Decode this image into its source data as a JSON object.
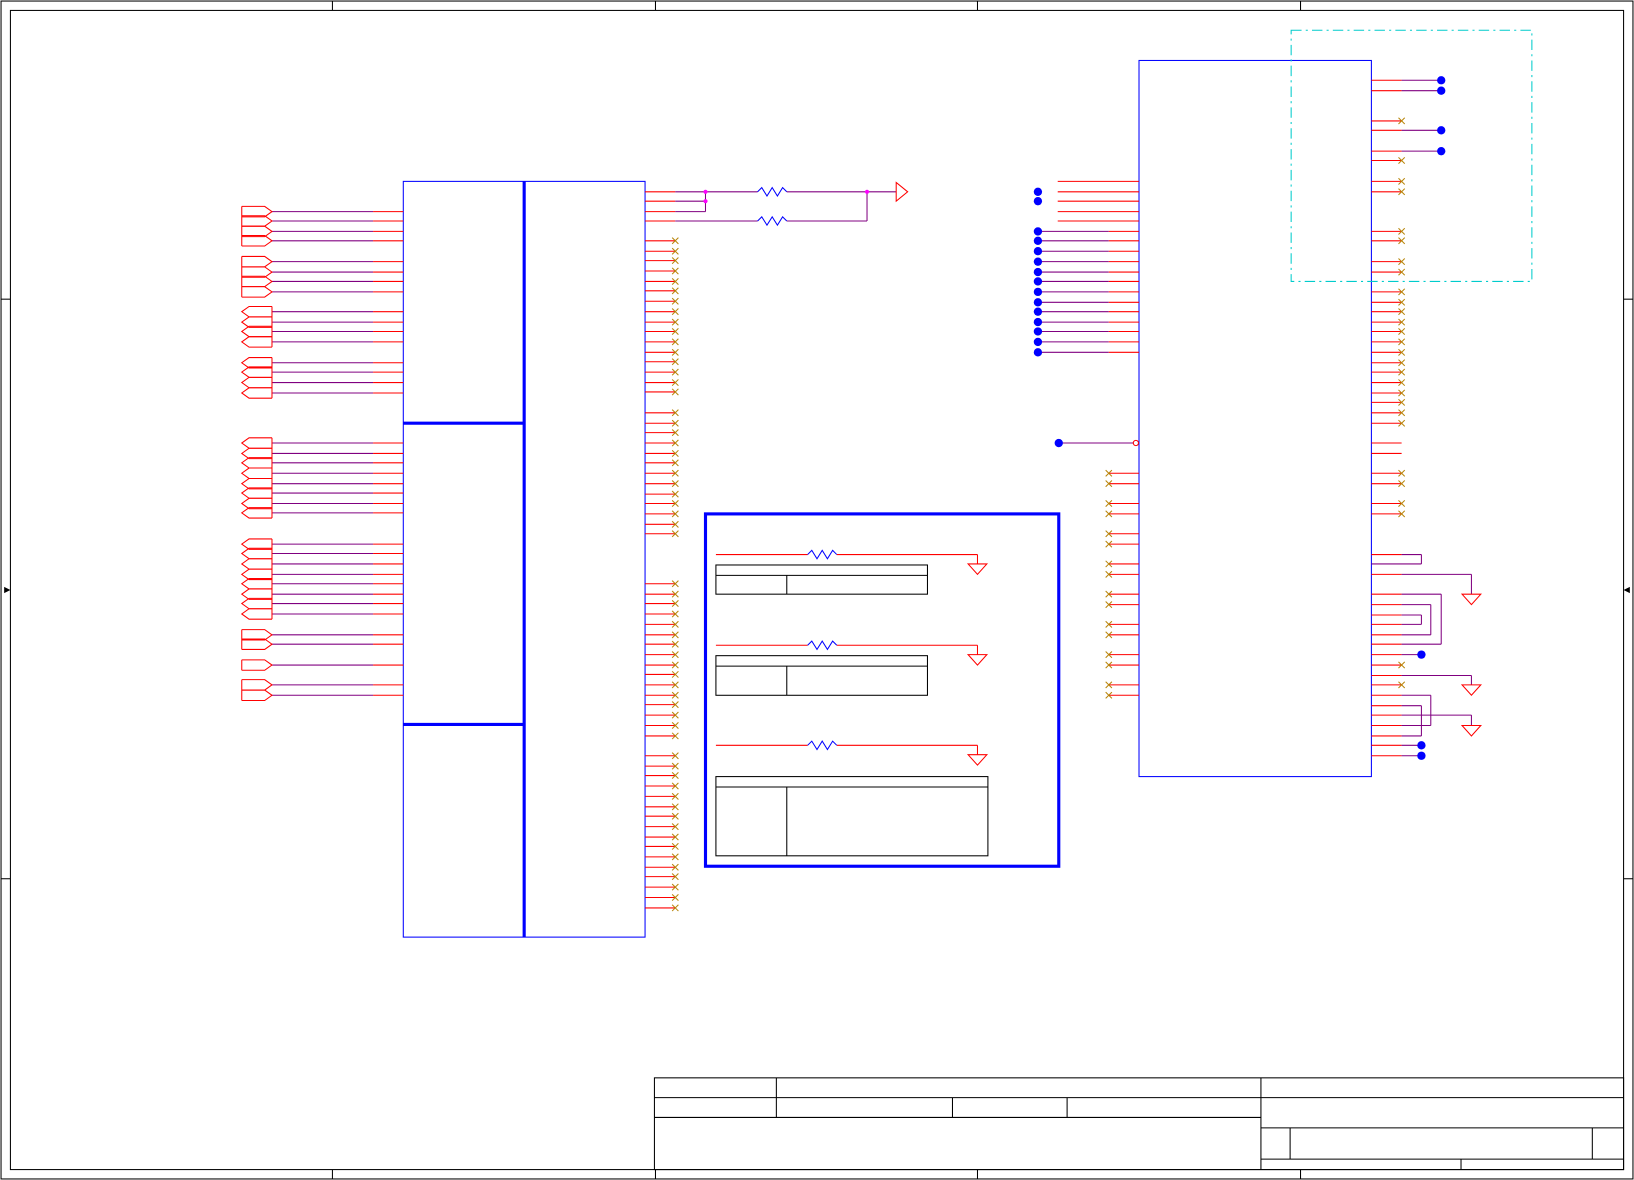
{
  "diagram": {
    "colors": {
      "frame": "#000000",
      "part": "#0000ff",
      "wire": "#ff0000",
      "net": "#800080",
      "junction": "#0000ff",
      "noconnect": "#b8860b",
      "region": "#00cccc",
      "marker": "#ff00ff"
    }
  }
}
